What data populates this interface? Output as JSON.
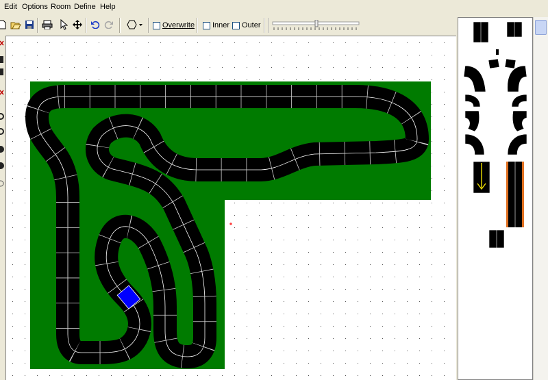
{
  "menu": {
    "items": [
      "Edit",
      "Options",
      "Room",
      "Define",
      "Help"
    ]
  },
  "toolbar": {
    "overwrite_label": "Overwrite",
    "inner_label": "Inner",
    "outer_label": "Outer",
    "icons": [
      "new-icon",
      "open-icon",
      "save-icon",
      "print-icon",
      "pointer-icon",
      "move-icon",
      "undo-icon",
      "redo-icon",
      "shape-icon"
    ]
  },
  "colors": {
    "grass": "#007b00",
    "track": "#000000",
    "track_lines": "#ffffff",
    "selected_piece": "#0000ff",
    "arrow": "#f0e000",
    "border_piece": "#e07020",
    "marker": "#ff0000"
  }
}
